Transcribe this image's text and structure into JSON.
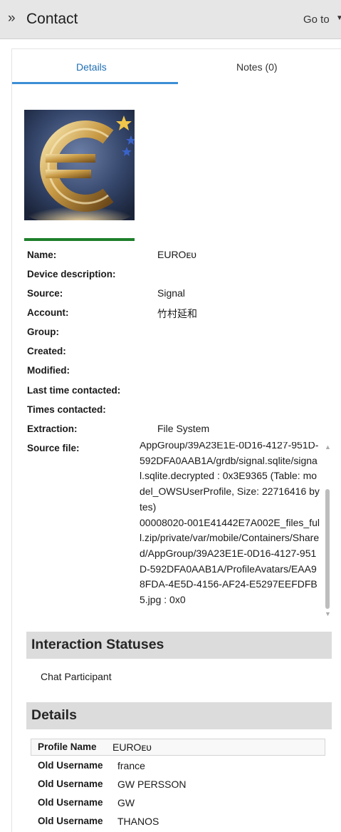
{
  "header": {
    "title": "Contact",
    "goto_label": "Go to"
  },
  "tabs": [
    {
      "label": "Details"
    },
    {
      "label": "Notes (0)"
    }
  ],
  "fields": [
    {
      "label": "Name:",
      "value": "EUROᴇᴜ"
    },
    {
      "label": "Device description:",
      "value": ""
    },
    {
      "label": "Source:",
      "value": "Signal"
    },
    {
      "label": "Account:",
      "value": "竹村延和"
    },
    {
      "label": "Group:",
      "value": ""
    },
    {
      "label": "Created:",
      "value": ""
    },
    {
      "label": "Modified:",
      "value": ""
    },
    {
      "label": "Last time contacted:",
      "value": ""
    },
    {
      "label": "Times contacted:",
      "value": ""
    },
    {
      "label": "Extraction:",
      "value": "File System"
    },
    {
      "label": "Source file:",
      "value": ""
    }
  ],
  "source_file_text": "AppGroup/39A23E1E-0D16-4127-951D-592DFA0AAB1A/grdb/signal.sqlite/signal.sqlite.decrypted : 0x3E9365 (Table: model_OWSUserProfile, Size: 22716416 bytes)\n00008020-001E41442E7A002E_files_full.zip/private/var/mobile/Containers/Shared/AppGroup/39A23E1E-0D16-4127-951D-592DFA0AAB1A/ProfileAvatars/EAA98FDA-4E5D-4156-AF24-E5297EEFDFB5.jpg : 0x0",
  "sections": {
    "interaction": "Interaction Statuses",
    "details": "Details"
  },
  "interaction_status": "Chat Participant",
  "profile_rows": [
    {
      "key": "Profile Name",
      "value": "EUROᴇᴜ"
    },
    {
      "key": "Old Username",
      "value": "france"
    },
    {
      "key": "Old Username",
      "value": "GW PERSSON"
    },
    {
      "key": "Old Username",
      "value": "GW"
    },
    {
      "key": "Old Username",
      "value": "THANOS"
    }
  ],
  "colors": {
    "accent": "#3b8ed6",
    "tab_active_text": "#1f6fb5",
    "status_bar": "#1d7f2a",
    "section_bg": "#dcdcdc"
  },
  "icons": {
    "header": "double-chevron-right-icon",
    "dropdown": "caret-down-icon"
  }
}
